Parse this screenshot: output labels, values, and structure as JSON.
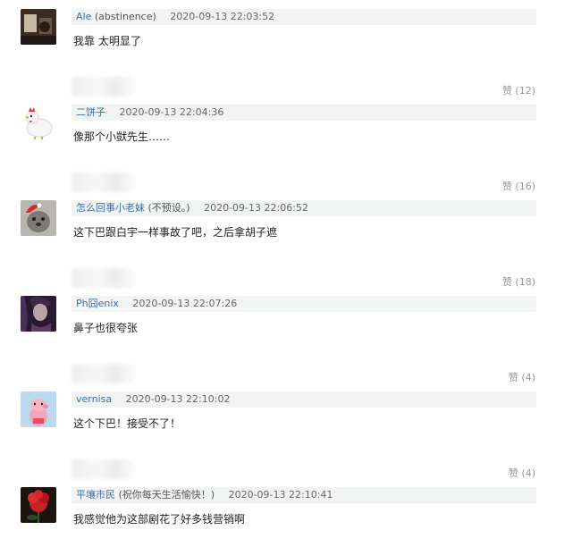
{
  "comments": [
    {
      "username": "Ale",
      "note": "(abstinence)",
      "time": "2020-09-13 22:03:52",
      "text": "我靠 太明显了",
      "likes": "赞 (12)"
    },
    {
      "username": "二饼子",
      "note": "",
      "time": "2020-09-13 22:04:36",
      "text": "像那个小獃先生……",
      "likes": "赞 (16)"
    },
    {
      "username": "怎么回事小老妹",
      "note": "(不预设。)",
      "time": "2020-09-13 22:06:52",
      "text": "这下巴跟白宇一样事故了吧，之后拿胡子遮",
      "likes": "赞 (18)"
    },
    {
      "username": "Ph囧enix",
      "note": "",
      "time": "2020-09-13 22:07:26",
      "text": "鼻子也很夸张",
      "likes": "赞 (4)"
    },
    {
      "username": "vernisa",
      "note": "",
      "time": "2020-09-13 22:10:02",
      "text": "这个下巴！接受不了！",
      "likes": "赞 (4)"
    },
    {
      "username": "平壤市民",
      "note": "(祝你每天生活愉快！)",
      "time": "2020-09-13 22:10:41",
      "text": "我感觉他为这部剧花了好多钱营销啊",
      "likes": ""
    }
  ]
}
